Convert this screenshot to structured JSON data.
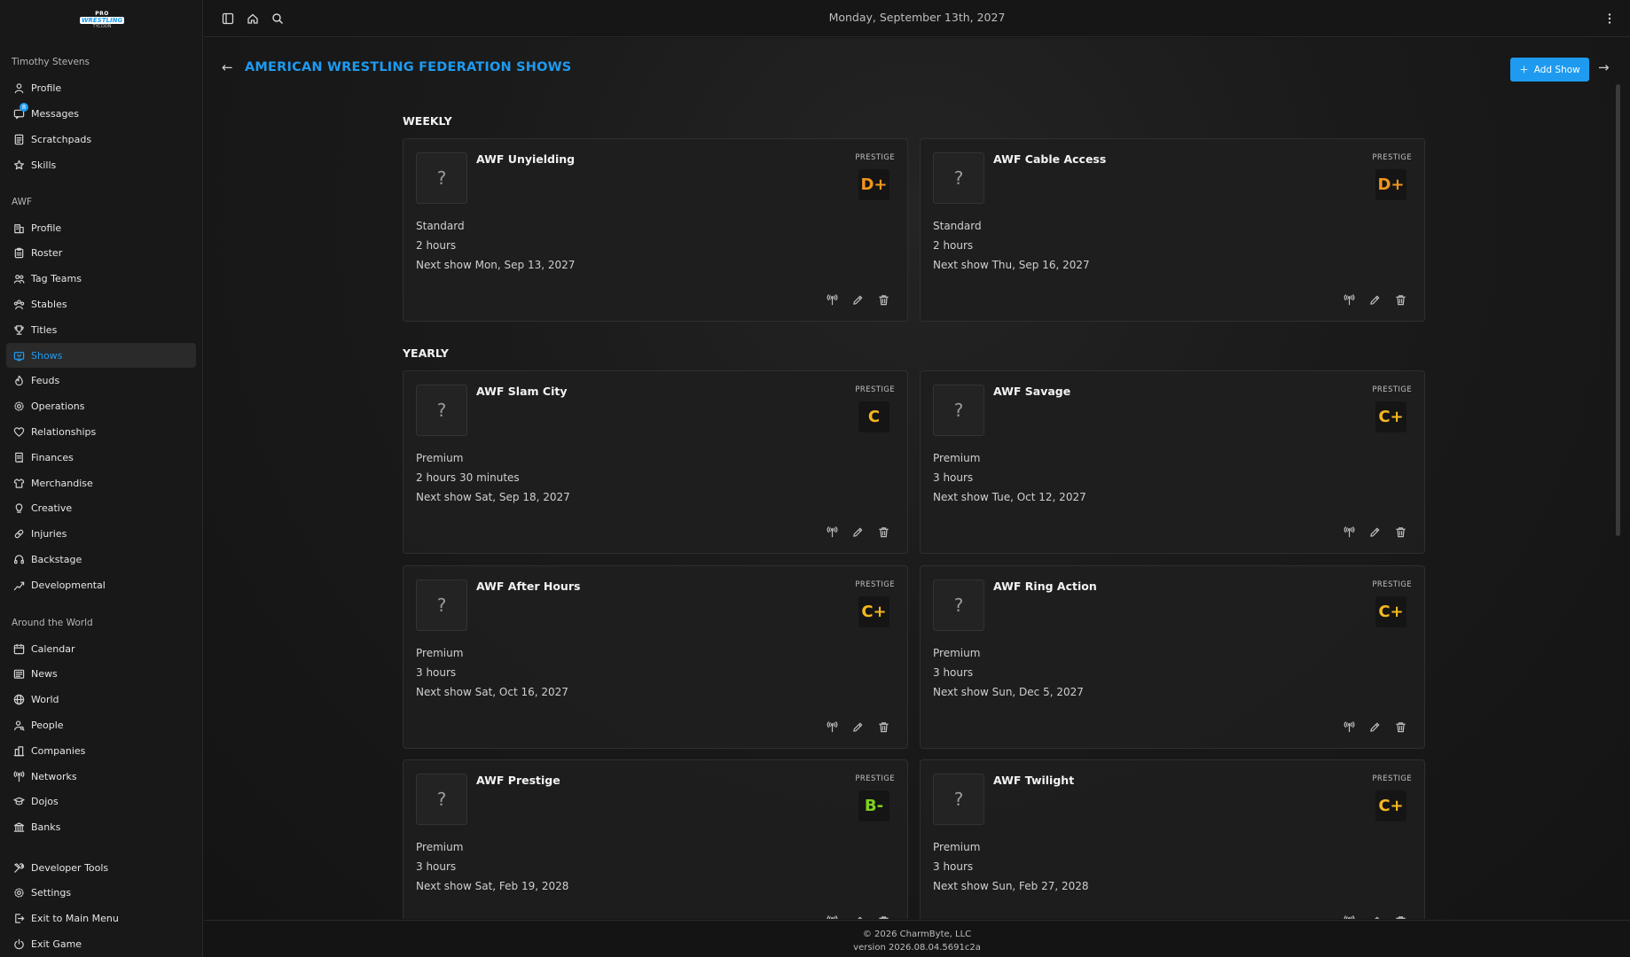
{
  "app": {
    "logo_lines": [
      "PRO",
      "WRESTLING",
      "TYCOON"
    ],
    "date": "Monday, September 13th, 2027"
  },
  "sidebar": {
    "user_name": "Timothy Stevens",
    "user_items": [
      {
        "label": "Profile",
        "icon": "person-icon"
      },
      {
        "label": "Messages",
        "icon": "messages-icon",
        "badge": "8"
      },
      {
        "label": "Scratchpads",
        "icon": "notepad-icon"
      },
      {
        "label": "Skills",
        "icon": "star-icon"
      }
    ],
    "company_label": "AWF",
    "company_items": [
      {
        "label": "Profile",
        "icon": "building-icon"
      },
      {
        "label": "Roster",
        "icon": "clipboard-icon"
      },
      {
        "label": "Tag Teams",
        "icon": "users-icon"
      },
      {
        "label": "Stables",
        "icon": "group-icon"
      },
      {
        "label": "Titles",
        "icon": "trophy-icon"
      },
      {
        "label": "Shows",
        "icon": "tv-icon",
        "active": true
      },
      {
        "label": "Feuds",
        "icon": "flame-icon"
      },
      {
        "label": "Operations",
        "icon": "gear-icon"
      },
      {
        "label": "Relationships",
        "icon": "heart-icon"
      },
      {
        "label": "Finances",
        "icon": "receipt-icon"
      },
      {
        "label": "Merchandise",
        "icon": "shirt-icon"
      },
      {
        "label": "Creative",
        "icon": "bulb-icon"
      },
      {
        "label": "Injuries",
        "icon": "bandage-icon"
      },
      {
        "label": "Backstage",
        "icon": "headset-icon"
      },
      {
        "label": "Developmental",
        "icon": "growth-icon"
      }
    ],
    "world_label": "Around the World",
    "world_items": [
      {
        "label": "Calendar",
        "icon": "calendar-icon"
      },
      {
        "label": "News",
        "icon": "newspaper-icon"
      },
      {
        "label": "World",
        "icon": "globe-icon"
      },
      {
        "label": "People",
        "icon": "person-search-icon"
      },
      {
        "label": "Companies",
        "icon": "company-icon"
      },
      {
        "label": "Networks",
        "icon": "antenna-icon"
      },
      {
        "label": "Dojos",
        "icon": "graduation-icon"
      },
      {
        "label": "Banks",
        "icon": "bank-icon"
      }
    ],
    "bottom_items": [
      {
        "label": "Developer Tools",
        "icon": "tools-icon"
      },
      {
        "label": "Settings",
        "icon": "gear-icon"
      },
      {
        "label": "Exit to Main Menu",
        "icon": "exit-icon"
      },
      {
        "label": "Exit Game",
        "icon": "power-icon"
      }
    ]
  },
  "main": {
    "title": "AMERICAN WRESTLING FEDERATION SHOWS",
    "add_button": "Add Show",
    "prestige_label": "PRESTIGE",
    "groups": [
      {
        "label": "WEEKLY",
        "shows": [
          {
            "name": "AWF Unyielding",
            "grade": "D+",
            "grade_color": "#f0961e",
            "tier": "Standard",
            "duration": "2 hours",
            "next": "Next show Mon, Sep 13, 2027",
            "thumb": "?"
          },
          {
            "name": "AWF Cable Access",
            "grade": "D+",
            "grade_color": "#f0961e",
            "tier": "Standard",
            "duration": "2 hours",
            "next": "Next show Thu, Sep 16, 2027",
            "thumb": "?"
          }
        ]
      },
      {
        "label": "YEARLY",
        "shows": [
          {
            "name": "AWF Slam City",
            "grade": "C",
            "grade_color": "#f5b81e",
            "tier": "Premium",
            "duration": "2 hours 30 minutes",
            "next": "Next show Sat, Sep 18, 2027",
            "thumb": "?"
          },
          {
            "name": "AWF Savage",
            "grade": "C+",
            "grade_color": "#f5b81e",
            "tier": "Premium",
            "duration": "3 hours",
            "next": "Next show Tue, Oct 12, 2027",
            "thumb": "?"
          },
          {
            "name": "AWF After Hours",
            "grade": "C+",
            "grade_color": "#f5b81e",
            "tier": "Premium",
            "duration": "3 hours",
            "next": "Next show Sat, Oct 16, 2027",
            "thumb": "?"
          },
          {
            "name": "AWF Ring Action",
            "grade": "C+",
            "grade_color": "#f5b81e",
            "tier": "Premium",
            "duration": "3 hours",
            "next": "Next show Sun, Dec 5, 2027",
            "thumb": "?"
          },
          {
            "name": "AWF Prestige",
            "grade": "B-",
            "grade_color": "#7fd11f",
            "tier": "Premium",
            "duration": "3 hours",
            "next": "Next show Sat, Feb 19, 2028",
            "thumb": "?"
          },
          {
            "name": "AWF Twilight",
            "grade": "C+",
            "grade_color": "#f5b81e",
            "tier": "Premium",
            "duration": "3 hours",
            "next": "Next show Sun, Feb 27, 2028",
            "thumb": "?"
          }
        ]
      }
    ]
  },
  "footer": {
    "copyright": "© 2026 CharmByte, LLC",
    "version": "version 2026.08.04.5691c2a"
  }
}
